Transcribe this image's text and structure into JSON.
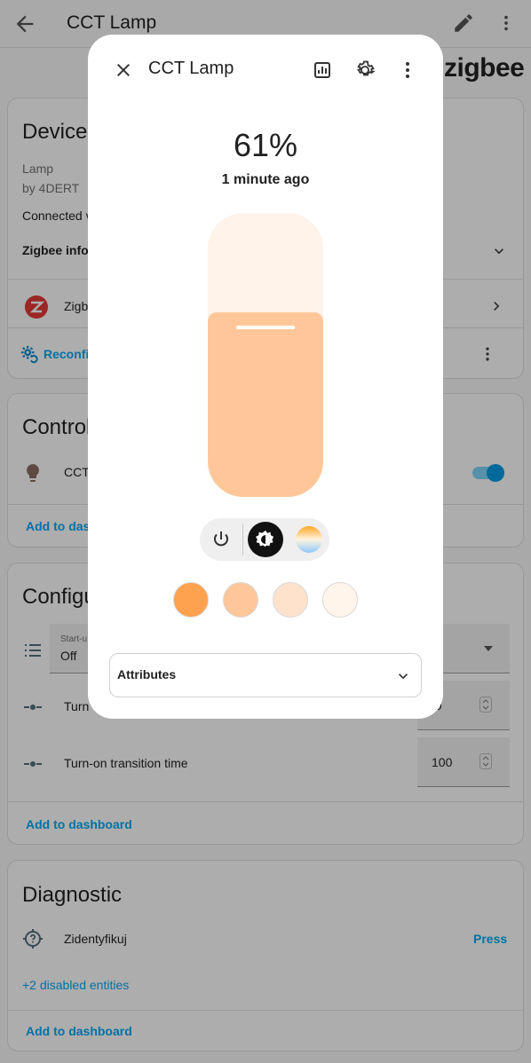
{
  "topbar": {
    "title": "CCT Lamp"
  },
  "brand": {
    "logo_text": "zigbee"
  },
  "device_card": {
    "title": "Device",
    "model": "Lamp",
    "manufacturer": "by 4DERT",
    "connected": "Connected v",
    "zigbee_info": "Zigbee info",
    "integration_label": "Zigb",
    "reconfigure_label": "Reconfig"
  },
  "controls_card": {
    "title": "Control",
    "entity_label": "CCT",
    "add_to_dashboard": "Add to dash"
  },
  "config_card": {
    "title": "Configu",
    "startup_field_label": "Start-u",
    "startup_field_value": "Off",
    "row1_label": "Turn",
    "row1_value": "00",
    "row2_label": "Turn-on transition time",
    "row2_value": "100",
    "add_to_dashboard": "Add to dashboard"
  },
  "diagnostic_card": {
    "title": "Diagnostic",
    "identify_label": "Zidentyfikuj",
    "press_label": "Press",
    "disabled_entities": "+2 disabled entities",
    "add_to_dashboard": "Add to dashboard"
  },
  "dialog": {
    "title": "CCT Lamp",
    "brightness_text": "61%",
    "brightness_level": 0.61,
    "last_changed": "1 minute ago",
    "attributes_label": "Attributes",
    "swatch_colors": [
      "#ffa24f",
      "#ffc799",
      "#ffe2cc",
      "#fff5eb"
    ]
  },
  "colors": {
    "accent": "#03a9f4",
    "switch_on": "#039be5",
    "slider_fill": "#ffc799",
    "slider_track": "#fff3ea",
    "zigbee_red": "#e53935",
    "bulb_brown": "#8d6e63"
  },
  "icons": {
    "back": "arrow-left-icon",
    "edit": "pencil-icon",
    "more": "dots-vertical-icon",
    "close": "close-icon",
    "history": "chart-box-icon",
    "settings": "cog-icon",
    "power": "power-icon",
    "brightness": "brightness-icon",
    "color_temp": "color-temperature-icon"
  }
}
